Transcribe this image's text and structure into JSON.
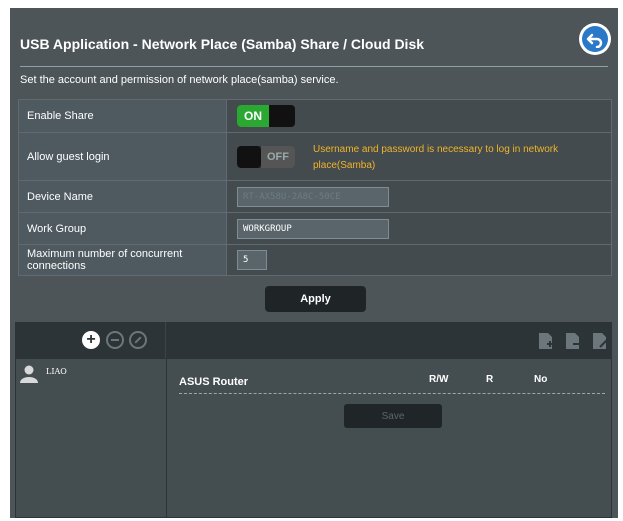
{
  "header": {
    "title": "USB Application - Network Place (Samba) Share / Cloud Disk"
  },
  "description": "Set the account and permission of network place(samba) service.",
  "settings": {
    "enable_share": {
      "label": "Enable Share",
      "state": "ON"
    },
    "allow_guest": {
      "label": "Allow guest login",
      "state": "OFF",
      "note": "Username and password is necessary to log in network place(Samba)"
    },
    "device_name": {
      "label": "Device Name",
      "value": "RT-AX58U-2A8C-50CE"
    },
    "work_group": {
      "label": "Work Group",
      "value": "WORKGROUP"
    },
    "max_connections": {
      "label": "Maximum number of concurrent connections",
      "value": "5"
    }
  },
  "apply_label": "Apply",
  "accounts": {
    "users": [
      "LIAO"
    ],
    "share_root": "ASUS Router",
    "permission_headers": [
      "R/W",
      "R",
      "No"
    ],
    "save_label": "Save"
  },
  "colors": {
    "panel": "#4d5558",
    "toggle_on": "#2aa832",
    "note": "#f0b429",
    "back_button": "#2a78c8"
  },
  "icons": [
    "back-icon",
    "add-user-icon",
    "remove-user-icon",
    "edit-user-icon",
    "add-folder-icon",
    "delete-folder-icon",
    "edit-folder-icon",
    "user-avatar-icon"
  ]
}
